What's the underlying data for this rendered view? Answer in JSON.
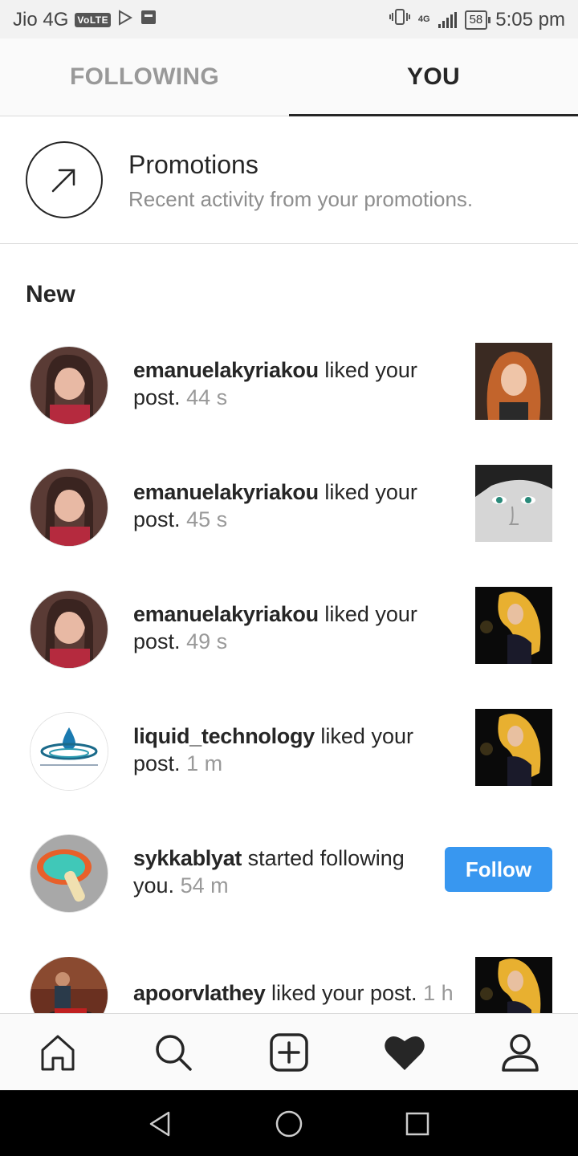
{
  "status_bar": {
    "carrier": "Jio 4G",
    "volte": "VoLTE",
    "network": "4G",
    "battery": "58",
    "time": "5:05 pm"
  },
  "tabs": [
    {
      "label": "FOLLOWING",
      "active": false
    },
    {
      "label": "YOU",
      "active": true
    }
  ],
  "promotions": {
    "title": "Promotions",
    "subtitle": "Recent activity from your promotions.",
    "icon": "arrow-up-right-icon"
  },
  "section_title": "New",
  "activity": [
    {
      "user": "emanuelakyriakou",
      "action": "liked your",
      "action2": "post.",
      "time": "44 s"
    },
    {
      "user": "emanuelakyriakou",
      "action": "liked your",
      "action2": "post.",
      "time": "45 s"
    },
    {
      "user": "emanuelakyriakou",
      "action": "liked your",
      "action2": "post.",
      "time": "49 s"
    },
    {
      "user": "liquid_technology",
      "action": "liked your",
      "action2": "post.",
      "time": "1 m"
    },
    {
      "user": "sykkablyat",
      "action": "started following",
      "action2": "you.",
      "time": "54 m",
      "button": "Follow"
    },
    {
      "user": "apoorvlathey",
      "action": "liked your post.",
      "time": "1 h"
    }
  ],
  "bottom_nav": [
    "home-icon",
    "search-icon",
    "new-post-icon",
    "heart-icon",
    "profile-icon"
  ],
  "colors": {
    "follow_button": "#3897f0",
    "text": "#262626",
    "muted": "#8e8e8e"
  }
}
